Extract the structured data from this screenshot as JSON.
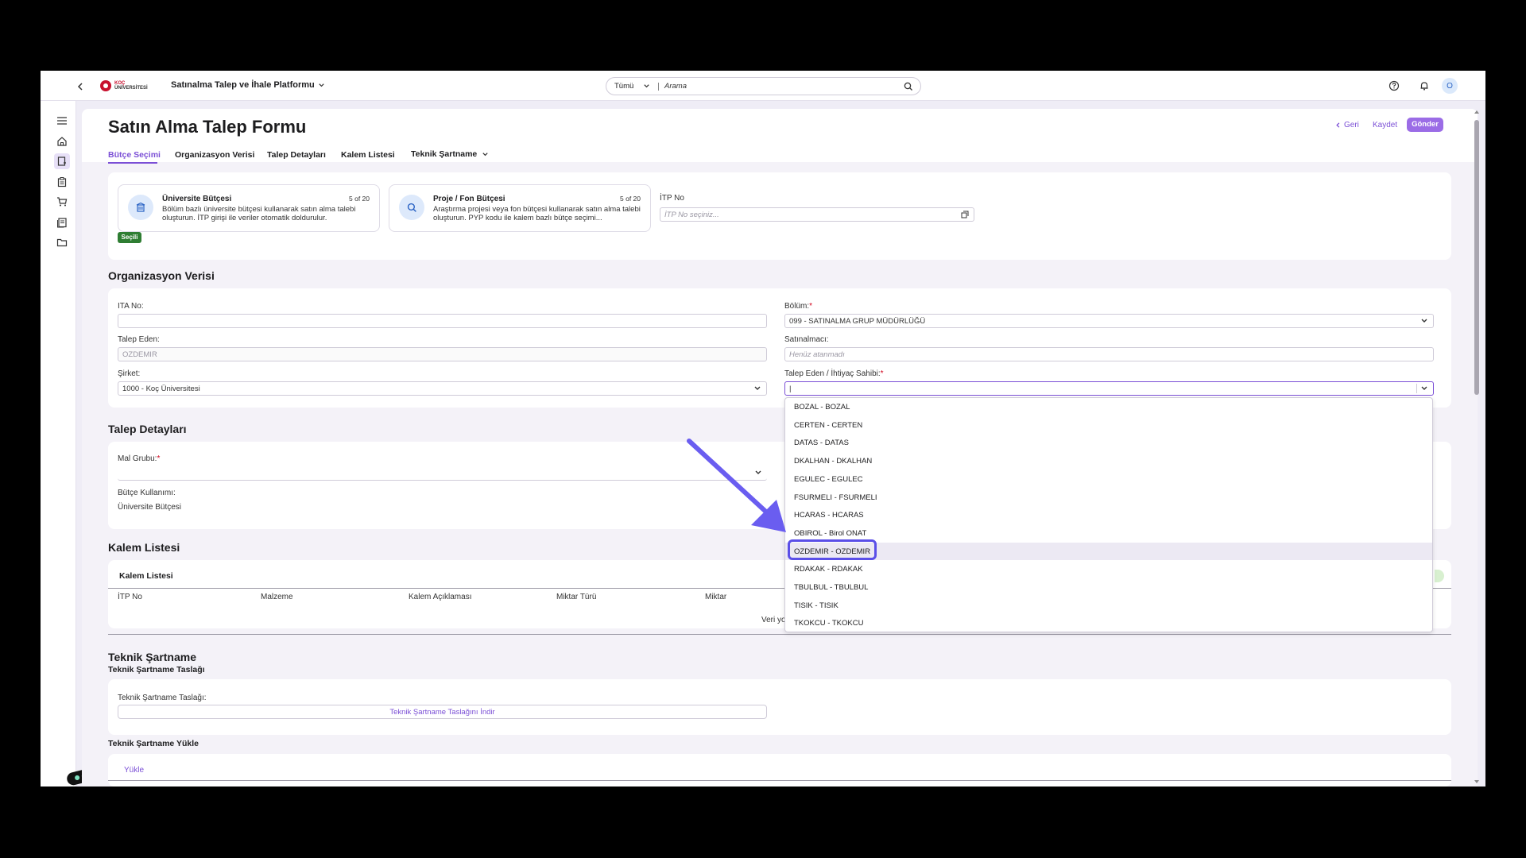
{
  "header": {
    "brand_line1": "KOÇ",
    "brand_line2": "ÜNİVERSİTESİ",
    "platform_title": "Satınalma Talep ve İhale Platformu",
    "search_scope": "Tümü",
    "search_placeholder": "Arama",
    "avatar_initial": "O"
  },
  "page": {
    "title": "Satın Alma Talep Formu",
    "back_label": "Geri",
    "save_label": "Kaydet",
    "send_label": "Gönder",
    "tabs": [
      {
        "label": "Bütçe Seçimi",
        "active": true
      },
      {
        "label": "Organizasyon Verisi"
      },
      {
        "label": "Talep Detayları"
      },
      {
        "label": "Kalem Listesi"
      },
      {
        "label": "Teknik Şartname"
      }
    ]
  },
  "budget": {
    "cards": [
      {
        "title": "Üniversite Bütçesi",
        "count": "5 of 20",
        "desc": "Bölüm bazlı üniversite bütçesi kullanarak satın alma talebi oluşturun. İTP girişi ile veriler otomatik doldurulur.",
        "badge": "Seçili"
      },
      {
        "title": "Proje / Fon Bütçesi",
        "count": "5 of 20",
        "desc": "Araştırma projesi veya fon bütçesi kullanarak satın alma talebi oluşturun. PYP kodu ile kalem bazlı bütçe seçimi..."
      }
    ],
    "itp_label": "İTP No",
    "itp_placeholder": "İTP No seçiniz..."
  },
  "org": {
    "title": "Organizasyon Verisi",
    "ita_label": "ITA No:",
    "ita_value": "",
    "requester_label": "Talep Eden:",
    "requester_value": "OZDEMIR",
    "company_label": "Şirket:",
    "company_value": "1000 - Koç Üniversitesi",
    "department_label": "Bölüm:",
    "department_value": "099 - SATINALMA GRUP MÜDÜRLÜĞÜ",
    "buyer_label": "Satınalmacı:",
    "buyer_placeholder": "Henüz atanmadı",
    "owner_label": "Talep Eden / İhtiyaç Sahibi:",
    "owner_value": "|"
  },
  "dropdown": {
    "items": [
      "BOZAL - BOZAL",
      "CERTEN - CERTEN",
      "DATAS - DATAS",
      "DKALHAN - DKALHAN",
      "EGULEC - EGULEC",
      "FSURMELI - FSURMELI",
      "HCARAS - HCARAS",
      "OBIROL - Birol ONAT",
      "OZDEMIR - OZDEMIR",
      "RDAKAK - RDAKAK",
      "TBULBUL - TBULBUL",
      "TISIK - TISIK",
      "TKOKCU - TKOKCU"
    ],
    "highlighted_index": 8
  },
  "details": {
    "title": "Talep Detayları",
    "goods_group_label": "Mal Grubu:",
    "budget_usage_label": "Bütçe Kullanımı:",
    "budget_usage_value": "Üniversite Bütçesi"
  },
  "items": {
    "title": "Kalem Listesi",
    "card_title": "Kalem Listesi",
    "columns": [
      "İTP No",
      "Malzeme",
      "Kalem Açıklaması",
      "Miktar Türü",
      "Miktar"
    ],
    "empty_text": "Veri yo"
  },
  "spec": {
    "title": "Teknik Şartname",
    "draft_title": "Teknik Şartname Taslağı",
    "draft_label": "Teknik Şartname Taslağı:",
    "download_label": "Teknik Şartname Taslağını İndir",
    "upload_title": "Teknik Şartname Yükle",
    "upload_label": "Yükle"
  },
  "colors": {
    "accent": "#7b4fd6",
    "badge_green": "#2e7d32",
    "highlight_border": "#5b4fe8",
    "arrow": "#6a5df0"
  }
}
